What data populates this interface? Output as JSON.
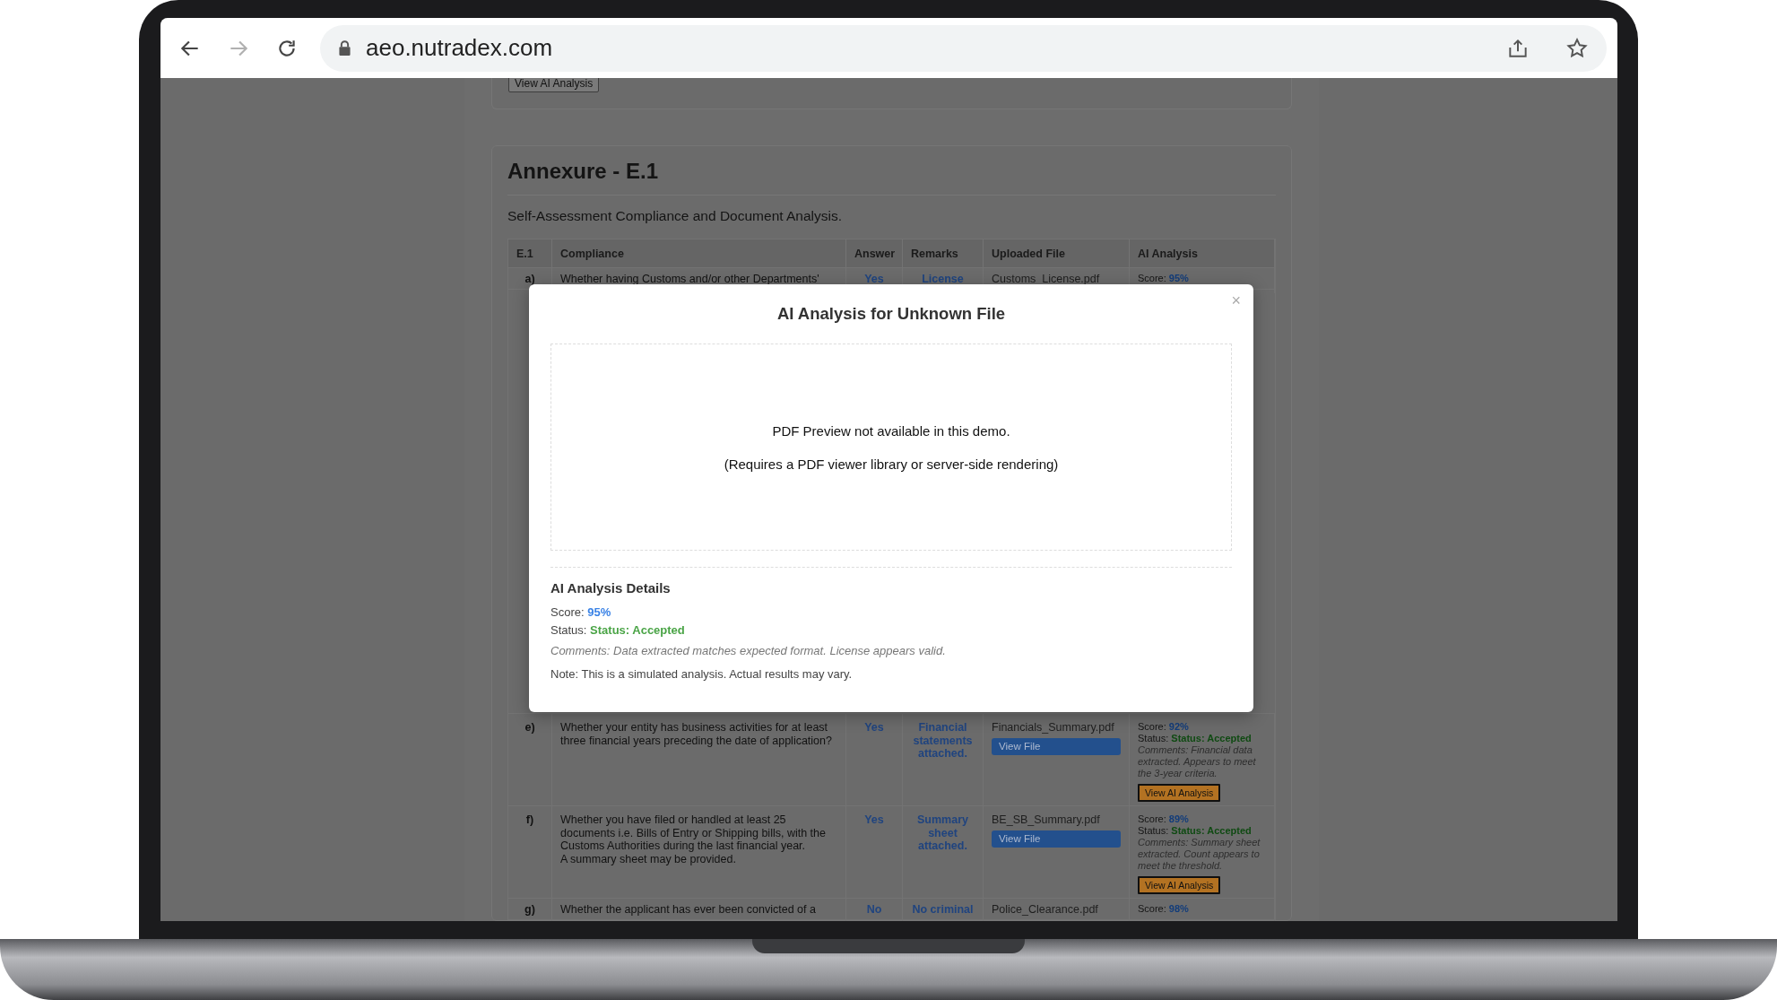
{
  "browser": {
    "url": "aeo.nutradex.com"
  },
  "previous_card": {
    "button": "View AI Analysis"
  },
  "section": {
    "title": "Annexure - E.1",
    "subtitle": "Self-Assessment Compliance and Document Analysis.",
    "table": {
      "columns": [
        "E.1",
        "Compliance",
        "Answer",
        "Remarks",
        "Uploaded File",
        "AI Analysis"
      ],
      "rows": [
        {
          "kind": "partial",
          "label": "a)",
          "compliance": [
            "Whether having Customs and/or other Departments'"
          ],
          "answer": "Yes",
          "remarks": "License",
          "file": "Customs_License.pdf",
          "ai": {
            "score_label": "Score:",
            "score": "95%"
          }
        },
        {
          "kind": "full",
          "label": "e)",
          "compliance": [
            "Whether your entity has business activities for at least",
            "three financial years preceding the date of application?"
          ],
          "answer": "Yes",
          "remarks": "Financial statements attached.",
          "file": "Financials_Summary.pdf",
          "view_file": "View File",
          "ai": {
            "score_label": "Score:",
            "score": "92%",
            "status_label": "Status:",
            "status": "Status: Accepted",
            "comments": "Comments: Financial data extracted. Appears to meet the 3-year criteria.",
            "button": "View AI Analysis"
          }
        },
        {
          "kind": "full",
          "label": "f)",
          "compliance": [
            "Whether you have filed or handled at least 25",
            "documents i.e. Bills of Entry or Shipping bills, with the",
            "Customs Authorities during the last financial year.",
            "A summary sheet may be provided."
          ],
          "answer": "Yes",
          "remarks": "Summary sheet attached.",
          "file": "BE_SB_Summary.pdf",
          "view_file": "View File",
          "ai": {
            "score_label": "Score:",
            "score": "89%",
            "status_label": "Status:",
            "status": "Status: Accepted",
            "comments": "Comments: Summary sheet extracted. Count appears to meet the threshold.",
            "button": "View AI Analysis"
          }
        },
        {
          "kind": "partial",
          "label": "g)",
          "compliance": [
            "Whether the applicant has ever been convicted of a"
          ],
          "answer": "No",
          "remarks": "No criminal",
          "file": "Police_Clearance.pdf",
          "ai": {
            "score_label": "Score:",
            "score": "98%"
          }
        }
      ]
    }
  },
  "modal": {
    "title": "AI Analysis for Unknown File",
    "close": "×",
    "preview": [
      "PDF Preview not available in this demo.",
      "(Requires a PDF viewer library or server-side rendering)"
    ],
    "details": {
      "heading": "AI Analysis Details",
      "score_label": "Score:",
      "score": "95%",
      "status_label": "Status:",
      "status": "Status: Accepted",
      "comments": "Comments: Data extracted matches expected format. License appears valid.",
      "note": "Note: This is a simulated analysis. Actual results may vary."
    }
  }
}
